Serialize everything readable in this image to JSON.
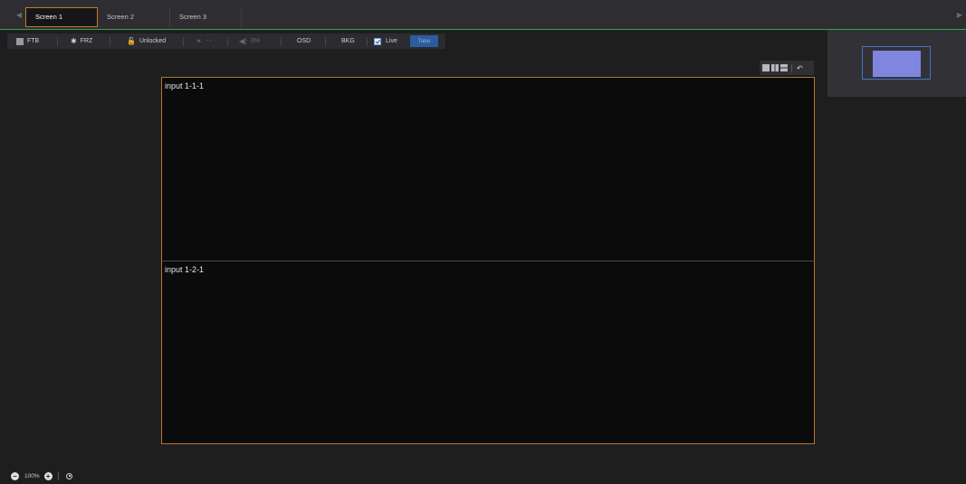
{
  "tabs": [
    {
      "label": "Screen 1",
      "active": true
    },
    {
      "label": "Screen 2",
      "active": false
    },
    {
      "label": "Screen 3",
      "active": false
    }
  ],
  "toolbar": {
    "ftb_label": "FTB",
    "frz_label": "FRZ",
    "lock_label": "Unlocked",
    "brightness_label": "- -",
    "volume_label": "0%",
    "osd_label": "OSD",
    "bkg_label": "BKG",
    "live_label": "Live",
    "live_checked": true,
    "take_label": "Take"
  },
  "windows": [
    {
      "label": "input 1-1-1"
    },
    {
      "label": "input 1-2-1"
    }
  ],
  "zoom": {
    "level": "100%"
  },
  "colors": {
    "accent_orange": "#b6742c",
    "tab_underline_green": "#3aa24a",
    "take_blue": "#2c5c9e",
    "preview_fill": "#7f86e0"
  }
}
